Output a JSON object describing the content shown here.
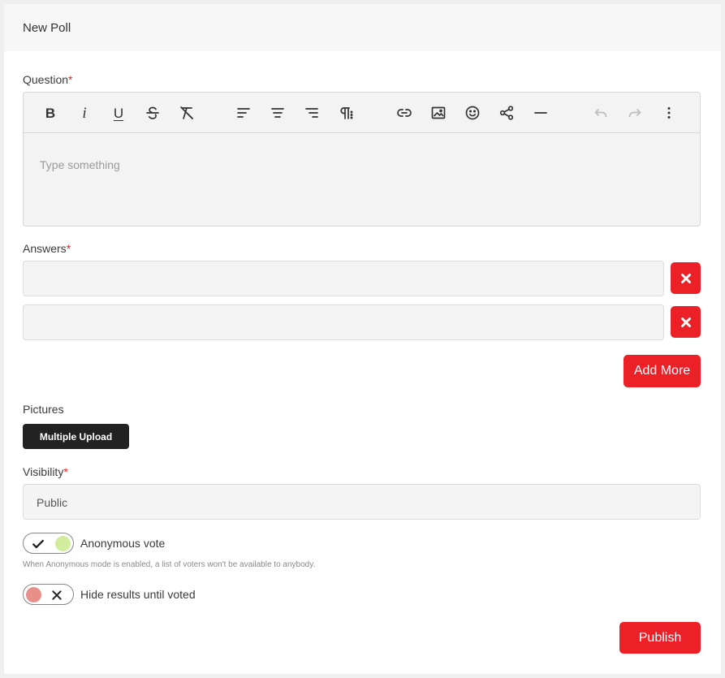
{
  "header": {
    "title": "New Poll"
  },
  "question": {
    "label": "Question",
    "required_mark": "*",
    "placeholder": "Type something",
    "toolbar": {
      "bold": "B",
      "italic": "i",
      "underline": "U"
    }
  },
  "answers": {
    "label": "Answers",
    "required_mark": "*",
    "items": [
      {
        "value": ""
      },
      {
        "value": ""
      }
    ],
    "add_more_label": "Add More"
  },
  "pictures": {
    "label": "Pictures",
    "upload_label": "Multiple Upload"
  },
  "visibility": {
    "label": "Visibility",
    "required_mark": "*",
    "selected": "Public"
  },
  "anonymous_vote": {
    "label": "Anonymous vote",
    "enabled": true,
    "hint": "When Anonymous mode is enabled, a list of voters won't be available to anybody."
  },
  "hide_results": {
    "label": "Hide results until voted",
    "enabled": false
  },
  "publish_label": "Publish",
  "colors": {
    "accent_red": "#ec2127",
    "toggle_on": "#d2ec9e",
    "toggle_off": "#e88f8a",
    "dark_button": "#222222"
  }
}
